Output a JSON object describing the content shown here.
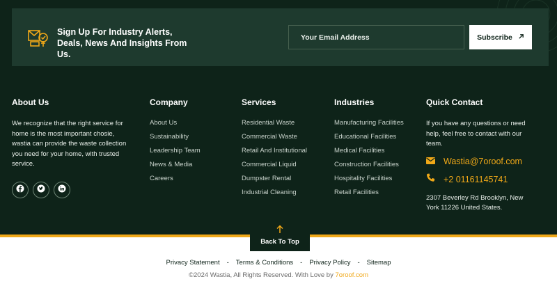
{
  "signup": {
    "text": "Sign Up For Industry Alerts, Deals, News And Insights From Us.",
    "email_placeholder": "Your Email Address",
    "subscribe_label": "Subscribe"
  },
  "about": {
    "title": "About Us",
    "text": "We recognize that the right service for home is the most important chosie, wastia can provide the waste collection you need for your home, with trusted service.",
    "social_icons": [
      "facebook-icon",
      "twitter-icon",
      "linkedin-icon"
    ]
  },
  "company": {
    "title": "Company",
    "links": [
      "About Us",
      "Sustainability",
      "Leadership Team",
      "News & Media",
      "Careers"
    ]
  },
  "services": {
    "title": "Services",
    "links": [
      "Residential Waste",
      "Commercial Waste",
      "Retail And Institutional",
      "Commercial Liquid",
      "Dumpster Rental",
      "Industrial Cleaning"
    ]
  },
  "industries": {
    "title": "Industries",
    "links": [
      "Manufacturing Facilities",
      "Educational Facilities",
      "Medical Facilities",
      "Construction Facilities",
      "Hospitality Facilities",
      "Retail Facilities"
    ]
  },
  "contact": {
    "title": "Quick Contact",
    "text": "If you have any questions or need help, feel free to contact with our team.",
    "email": "Wastia@7oroof.com",
    "phone": "+2 01161145741",
    "address": "2307 Beverley Rd Brooklyn, New York 11226 United States."
  },
  "back_to_top": {
    "label": "Back To Top"
  },
  "legal": {
    "links": [
      "Privacy Statement",
      "Terms & Conditions",
      "Privacy Policy",
      "Sitemap"
    ],
    "separator": "-",
    "copyright_prefix": "©2024 Wastia, All Rights Reserved. With Love by",
    "copyright_brand": "7oroof.com"
  },
  "colors": {
    "background": "#0e2319",
    "card": "#1e3a2e",
    "accent": "#f0a818",
    "text_light": "#ffffff"
  }
}
